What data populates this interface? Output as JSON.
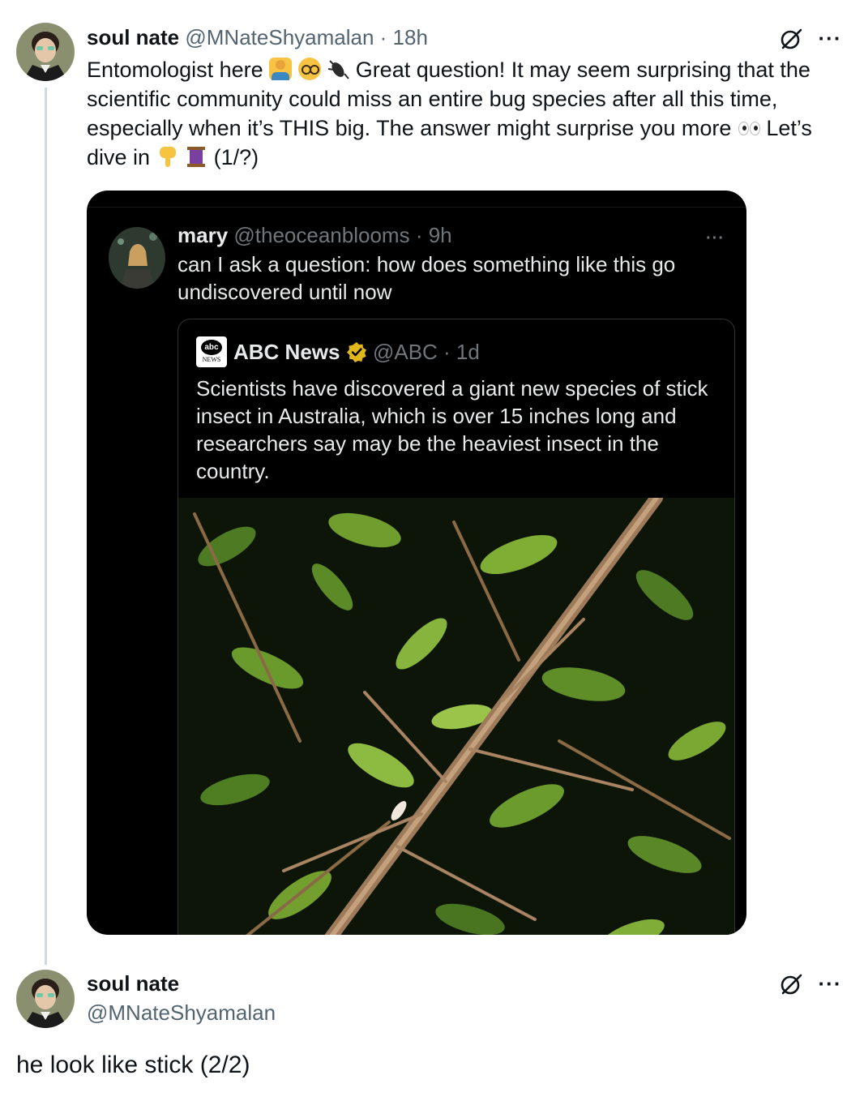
{
  "tweet1": {
    "display_name": "soul nate",
    "handle": "@MNateShyamalan",
    "time": "· 18h",
    "text_part1": "Entomologist here",
    "text_part2": " Great question! It may seem surprising that the scientific community could miss an entire bug species after all this time, especially when it’s THIS big. The answer might surprise you more",
    "text_part3": " Let’s dive in",
    "text_part4": " (1/?)",
    "more_label": "···"
  },
  "quoted": {
    "display_name": "mary",
    "handle": "@theoceanblooms",
    "time": "· 9h",
    "text": "can I ask a question: how does something like this go undiscovered until now",
    "more_label": "···",
    "nested": {
      "logo_text_top": "abc",
      "logo_text_bottom": "NEWS",
      "display_name": "ABC News",
      "handle": "@ABC",
      "time": "· 1d",
      "text": "Scientists have discovered a giant new species of stick insect in Australia, which is over 15 inches long and researchers say may be the heaviest insect in the country."
    }
  },
  "tweet2": {
    "display_name": "soul nate",
    "handle": "@MNateShyamalan",
    "text": "he look like stick (2/2)",
    "more_label": "···"
  },
  "icons": {
    "grok": "grok-icon",
    "more": "more-icon",
    "verified": "verified-badge-icon"
  },
  "colors": {
    "verified_gold": "#e2b719",
    "thread_line": "#cfd9de",
    "text_primary": "#0f1419",
    "text_muted": "#536471"
  }
}
